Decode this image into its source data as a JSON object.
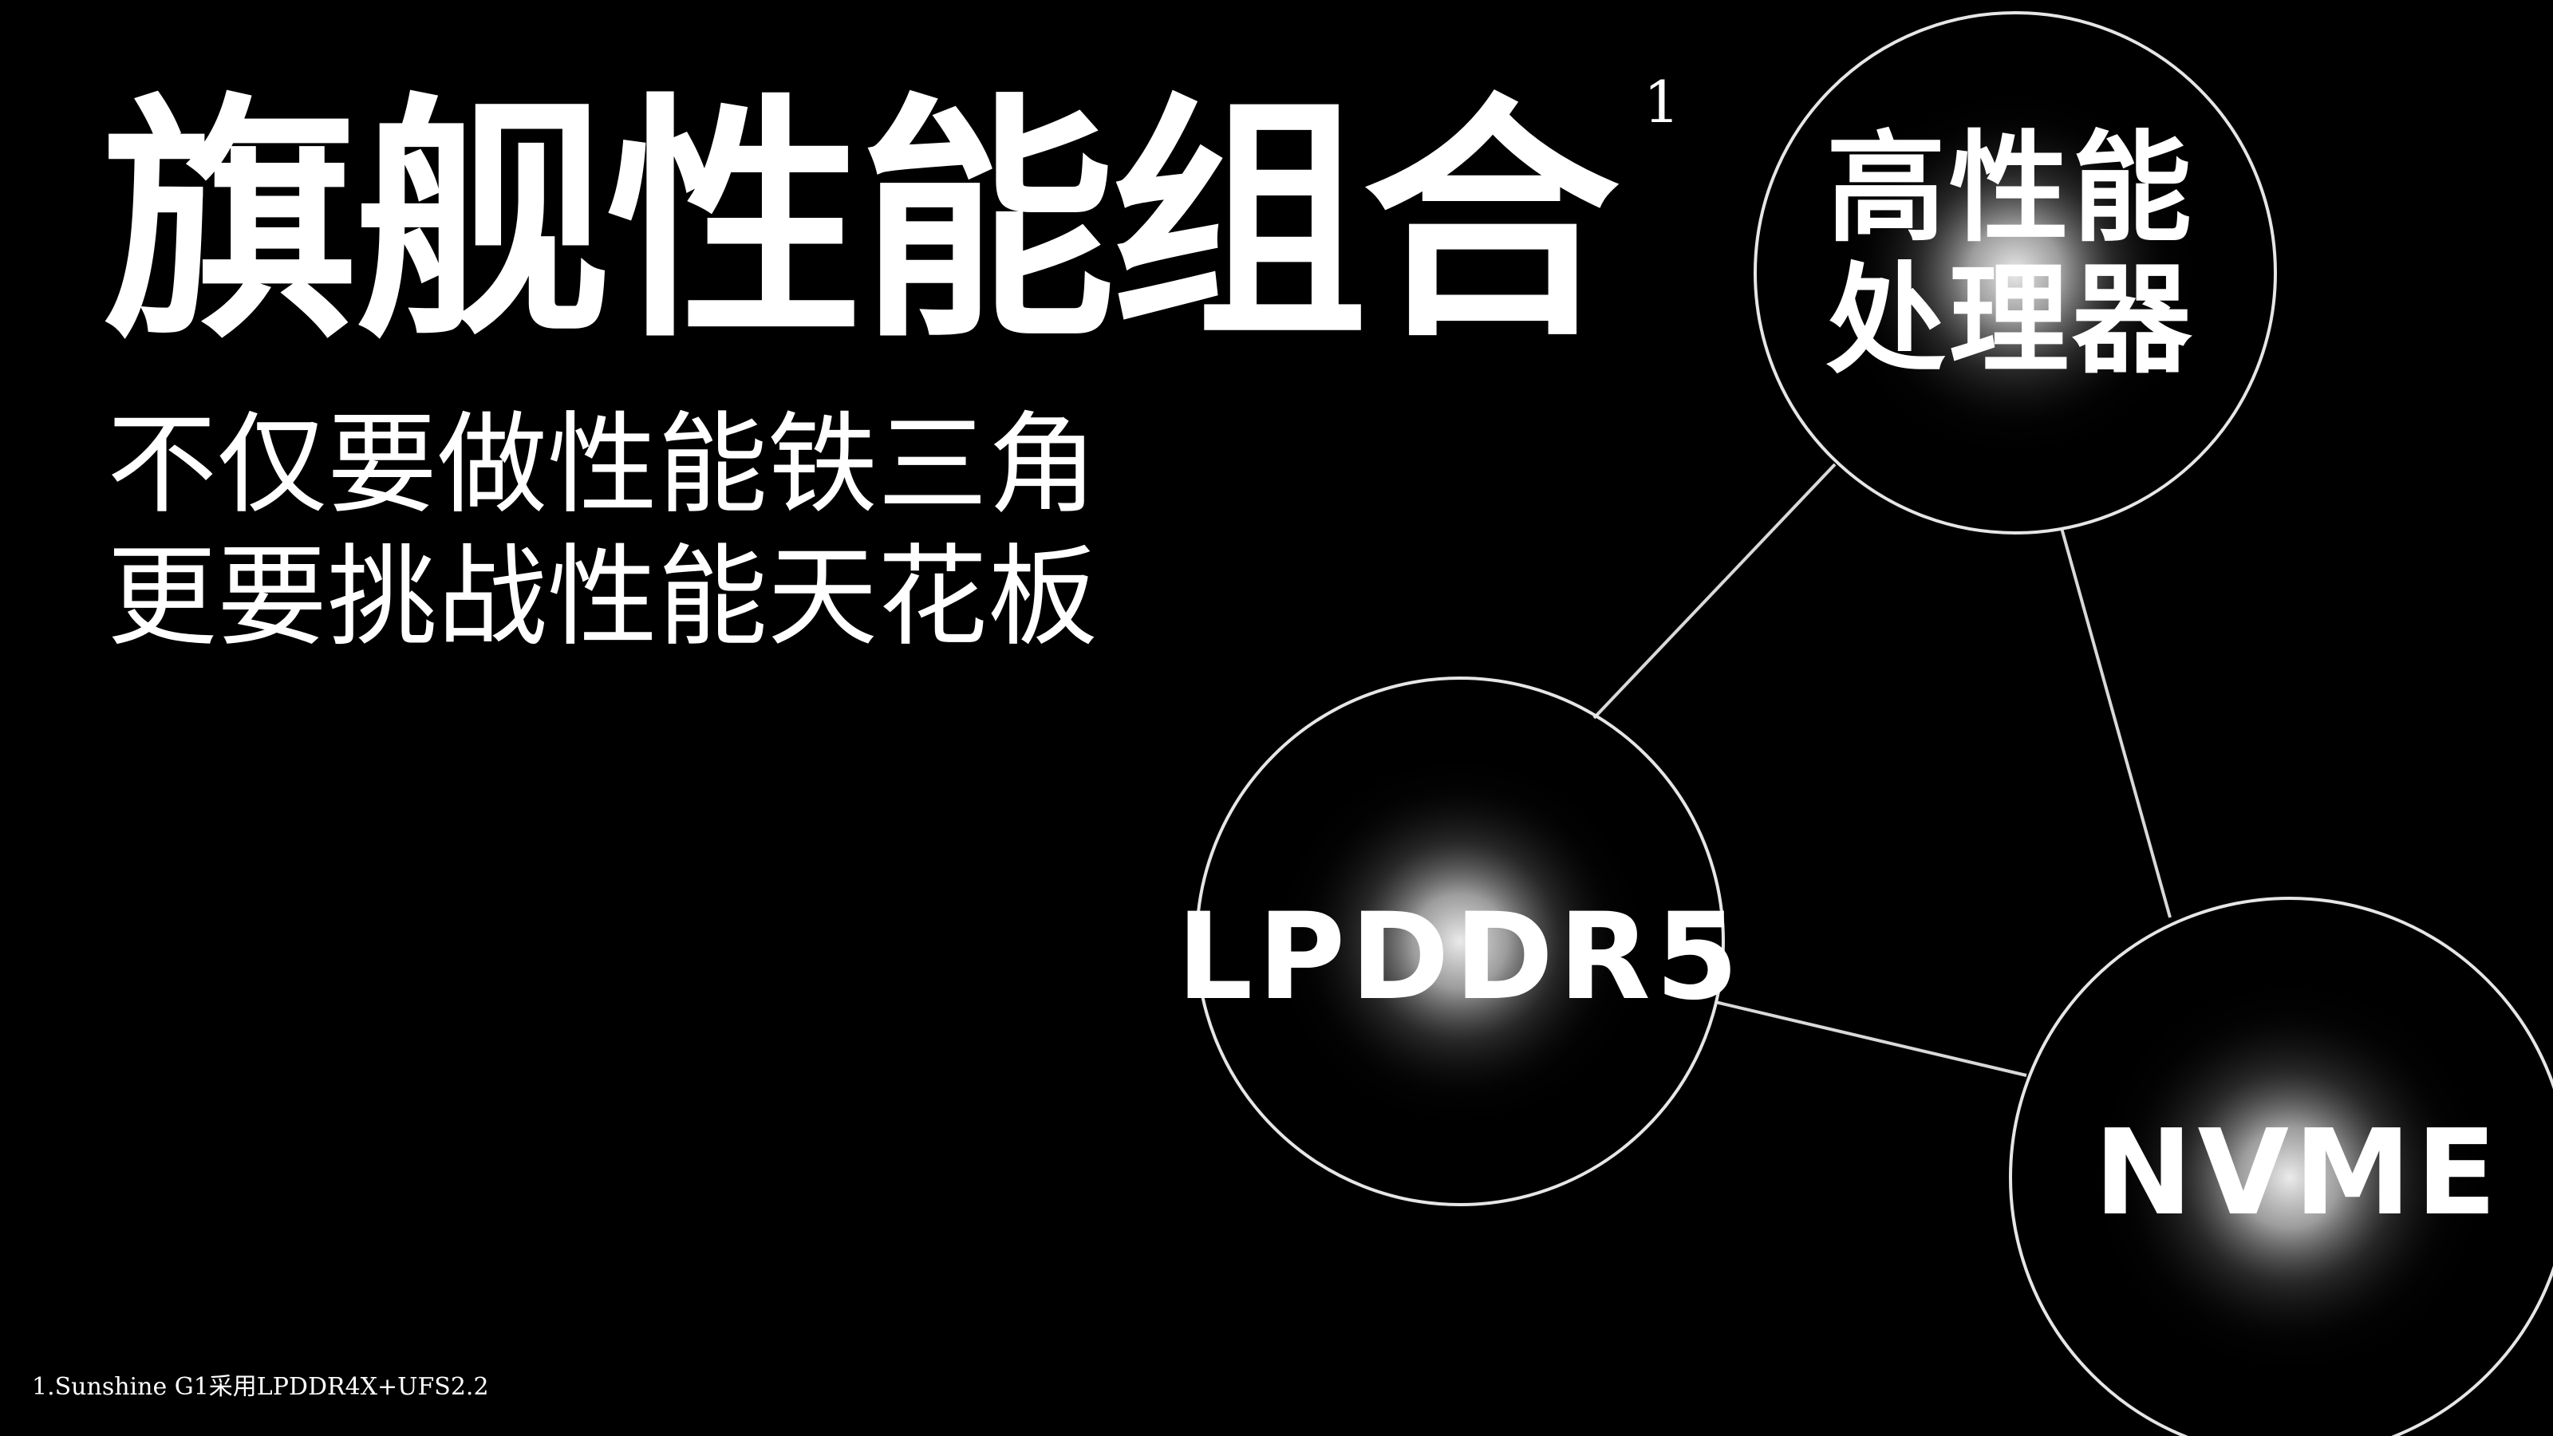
{
  "headline": {
    "title": "旗舰性能组合",
    "footnote_marker": "1",
    "subtitle_line1": "不仅要做性能铁三角",
    "subtitle_line2": "更要挑战性能天花板"
  },
  "diagram": {
    "nodes": {
      "cpu": {
        "line1": "高性能",
        "line2": "处理器"
      },
      "memory": {
        "label": "LPDDR5"
      },
      "storage": {
        "label": "NVME"
      }
    }
  },
  "footer": {
    "note": "1.Sunshine G1采用LPDDR4X+UFS2.2"
  },
  "colors": {
    "background": "#000000",
    "foreground": "#ffffff",
    "circle_glow": "#ffffff"
  }
}
